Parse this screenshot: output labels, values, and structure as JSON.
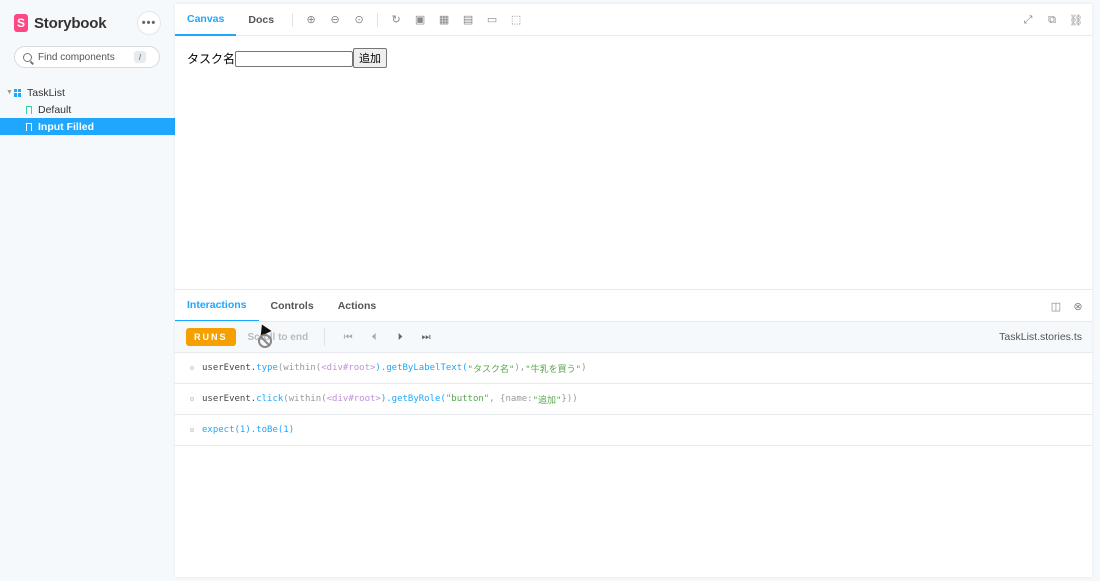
{
  "brand": {
    "name": "Storybook",
    "logo_letter": "S"
  },
  "sidebar": {
    "menu_label": "•••",
    "search": {
      "placeholder": "Find components",
      "shortcut": "/"
    },
    "tree": {
      "group": "TaskList",
      "stories": [
        {
          "label": "Default",
          "selected": false
        },
        {
          "label": "Input Filled",
          "selected": true
        }
      ]
    }
  },
  "toolbar": {
    "tabs": [
      {
        "label": "Canvas",
        "active": true
      },
      {
        "label": "Docs",
        "active": false
      }
    ],
    "tools": [
      "zoom-in-icon",
      "zoom-out-icon",
      "zoom-reset-icon",
      "reload-icon",
      "image-icon",
      "grid-icon",
      "background-icon",
      "viewport-icon",
      "outline-icon"
    ],
    "right_tools": [
      "fullscreen-icon",
      "open-new-tab-icon",
      "copy-link-icon"
    ]
  },
  "canvas": {
    "label": "タスク名",
    "input_value": "",
    "button_label": "追加"
  },
  "addons": {
    "tabs": [
      {
        "label": "Interactions",
        "active": true
      },
      {
        "label": "Controls",
        "active": false
      },
      {
        "label": "Actions",
        "active": false
      }
    ],
    "runs_label": "RUNS",
    "scroll_label": "Scroll to end",
    "filename": "TaskList.stories.ts",
    "logs": [
      {
        "obj": "userEvent.",
        "fn": "type",
        "p1": "(within(",
        "tag": "<div#root>",
        "p2": ").getByLabelText(",
        "s1": "\"タスク名\"",
        "p3": "), ",
        "s2": "\"牛乳を買う\"",
        "p4": ")"
      },
      {
        "obj": "userEvent.",
        "fn": "click",
        "p1": "(within(",
        "tag": "<div#root>",
        "p2": ").getByRole(",
        "s1": "\"button\"",
        "p3": ", { ",
        "k": "name: ",
        "s2": "\"追加\"",
        "p4": " }))"
      },
      {
        "text": "expect(1).toBe(1)"
      }
    ]
  },
  "colors": {
    "accent": "#1ea7fd",
    "brand": "#ff4785",
    "runs": "#f6a000",
    "selected_bg": "#1ea7fd"
  }
}
